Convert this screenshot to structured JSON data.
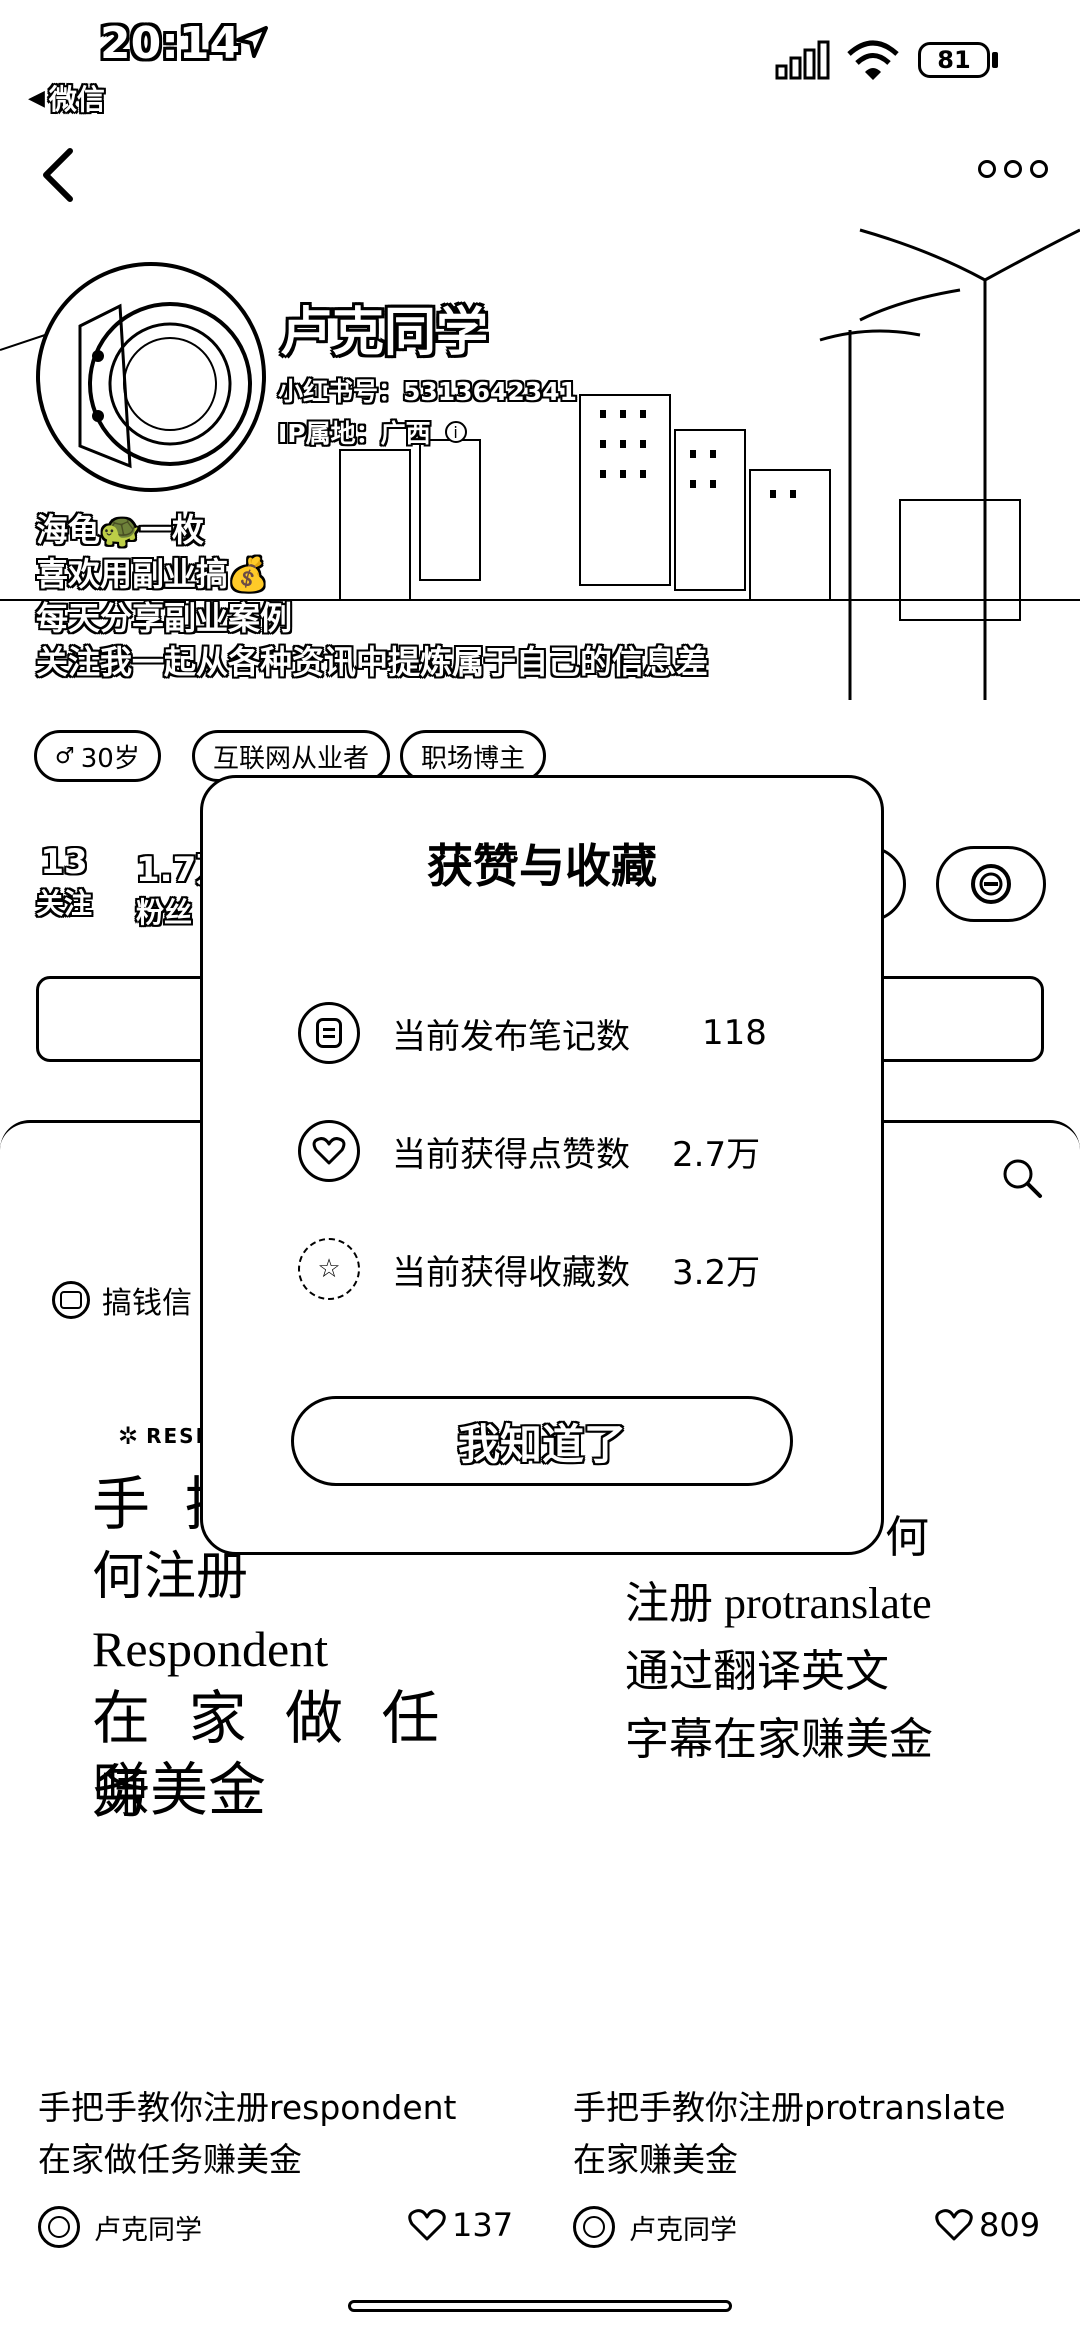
{
  "status_bar": {
    "time": "20:14",
    "back_app": "微信",
    "battery": "81"
  },
  "profile": {
    "name": "卢克同学",
    "id_label": "小红书号：5313642341",
    "ip_label": "IP属地：广西",
    "bio": [
      "海龟🐢一枚",
      "喜欢用副业搞💰",
      "每天分享副业案例",
      "关注我一起从各种资讯中提炼属于自己的信息差"
    ],
    "tags": [
      "30岁",
      "互联网从业者",
      "职场博主"
    ],
    "stats": [
      {
        "num": "13",
        "label": "关注"
      },
      {
        "num": "1.7万",
        "label": "粉丝"
      }
    ]
  },
  "collection_chip": "搞钱信",
  "modal": {
    "title": "获赞与收藏",
    "rows": [
      {
        "label": "当前发布笔记数",
        "value": "118"
      },
      {
        "label": "当前获得点赞数",
        "value": "2.7万"
      },
      {
        "label": "当前获得收藏数",
        "value": "3.2万"
      }
    ],
    "button": "我知道了"
  },
  "cards": [
    {
      "brand": "RESP",
      "cover_lines": [
        "手 把",
        "何注册",
        "Respondent",
        "在 家 做 任 务",
        "赚美金"
      ],
      "title_lines": [
        "手把手教你注册respondent",
        "在家做任务赚美金"
      ],
      "author": "卢克同学",
      "likes": "137"
    },
    {
      "cover_lines": [
        "何",
        "注册 protranslate",
        "通过翻译英文",
        "字幕在家赚美金"
      ],
      "title_lines": [
        "手把手教你注册protranslate",
        "在家赚美金"
      ],
      "author": "卢克同学",
      "likes": "809"
    }
  ]
}
